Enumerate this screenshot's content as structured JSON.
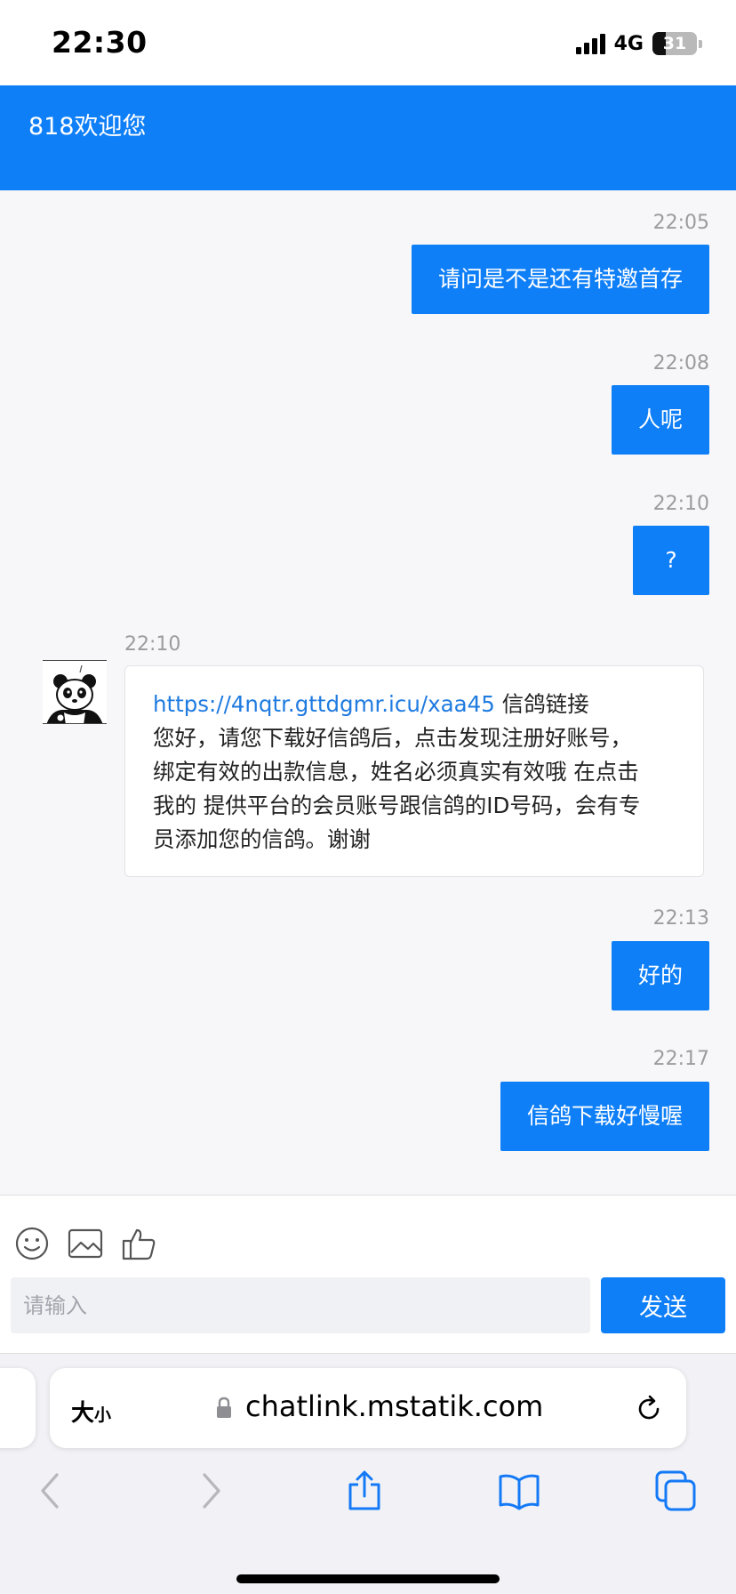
{
  "status_bar": {
    "time": "22:30",
    "network": "4G",
    "battery": "31"
  },
  "header": {
    "title": "818欢迎您"
  },
  "messages": [
    {
      "time": "22:05",
      "text": "请问是不是还有特邀首存"
    },
    {
      "time": "22:08",
      "text": "人呢"
    },
    {
      "time": "22:10",
      "text": "?"
    },
    {
      "time": "22:10",
      "link": "https://4nqtr.gttdgmr.icu/xaa45",
      "link_suffix": " 信鸽链接",
      "lines": [
        "您好，请您下载好信鸽后，点击发现注册好账号，",
        "绑定有效的出款信息，姓名必须真实有效哦 在点击",
        "我的 提供平台的会员账号跟信鸽的ID号码，会有专",
        "员添加您的信鸽。谢谢"
      ]
    },
    {
      "time": "22:13",
      "text": "好的"
    },
    {
      "time": "22:17",
      "text": "信鸽下载好慢喔"
    }
  ],
  "composer": {
    "placeholder": "请输入",
    "send_label": "发送",
    "icons": [
      "emoji-icon",
      "image-icon",
      "thumbs-up-icon"
    ]
  },
  "browser": {
    "text_size_big": "大",
    "text_size_small": "小",
    "url": "chatlink.mstatik.com"
  },
  "colors": {
    "accent": "#0f7ff7",
    "link": "#1f7be0",
    "timestamp": "#9b9ba0"
  }
}
